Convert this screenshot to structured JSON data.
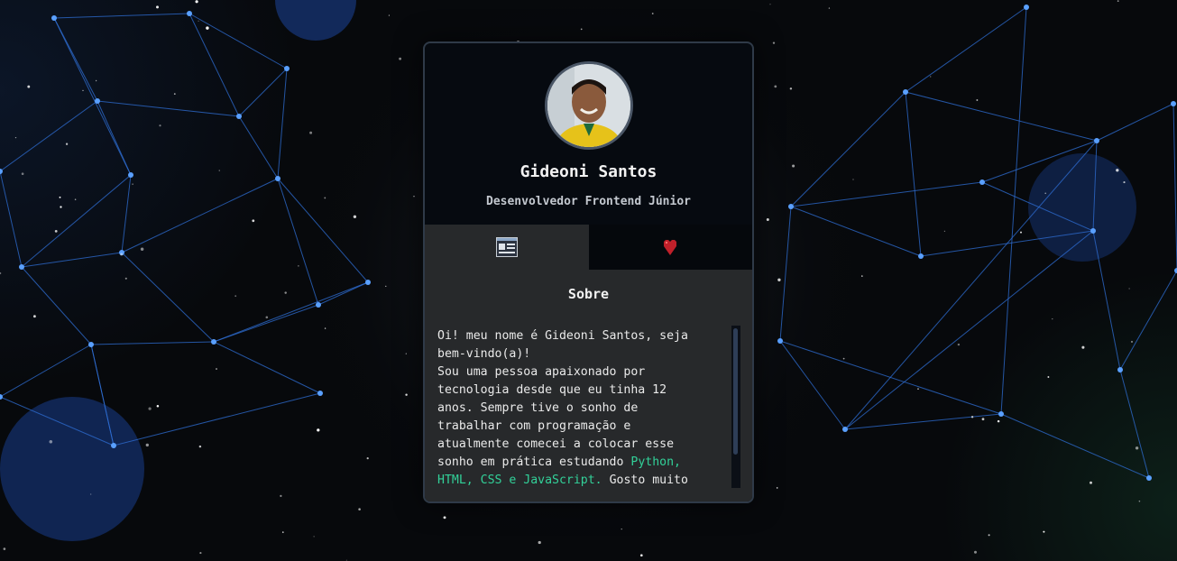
{
  "profile": {
    "name": "Gideoni Santos",
    "role": "Desenvolvedor Frontend Júnior"
  },
  "tabs": [
    {
      "icon": "about-card-icon",
      "active": true
    },
    {
      "icon": "heart-icon",
      "active": false
    }
  ],
  "about": {
    "title": "Sobre",
    "text_part1": "Oi! meu nome é Gideoni Santos, seja bem-vindo(a)!\nSou uma pessoa apaixonado por tecnologia desde que eu tinha 12 anos. Sempre tive o sonho de trabalhar com programação e atualmente comecei a colocar esse sonho em prática estudando ",
    "highlight": "Python, HTML, CSS e JavaScript.",
    "text_part2": " Gosto muito de andar de"
  },
  "colors": {
    "highlight": "#32d199",
    "card_bg": "#060a10",
    "panel_bg": "#27292b",
    "network_line": "#2f6fd6",
    "network_node": "#5aa0ff",
    "heart": "#c0202a"
  }
}
